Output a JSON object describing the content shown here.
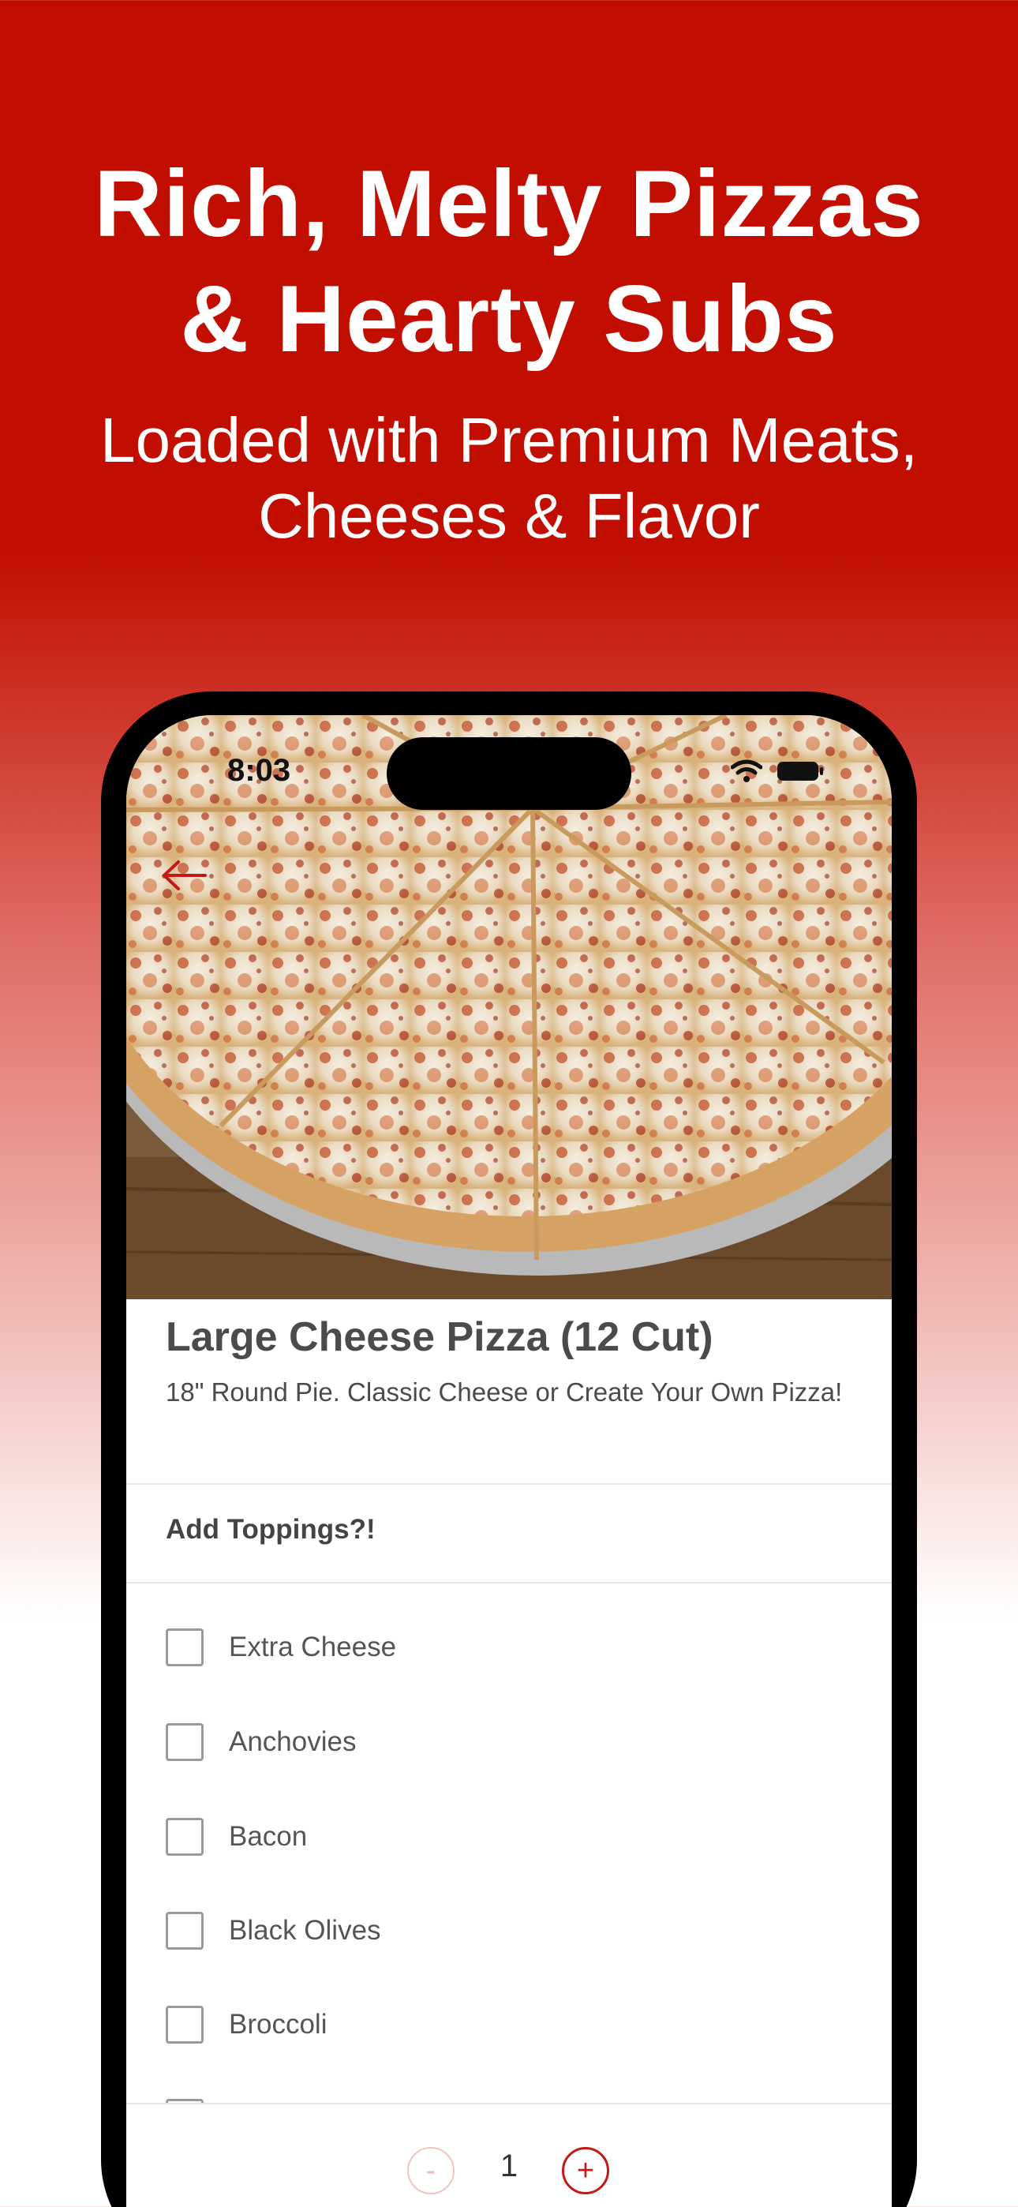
{
  "promo": {
    "headline_line1": "Rich, Melty Pizzas",
    "headline_line2": "& Hearty Subs",
    "subline_line1": "Loaded with Premium Meats,",
    "subline_line2": "Cheeses & Flavor"
  },
  "status_bar": {
    "time": "8:03",
    "icons": [
      "wifi-icon",
      "battery-icon"
    ]
  },
  "item": {
    "title": "Large Cheese Pizza (12 Cut)",
    "description": "18\" Round Pie. Classic Cheese or Create Your Own Pizza!"
  },
  "toppings": {
    "section_label": "Add Toppings?!",
    "options": [
      {
        "label": "Extra Cheese",
        "checked": false
      },
      {
        "label": "Anchovies",
        "checked": false
      },
      {
        "label": "Bacon",
        "checked": false
      },
      {
        "label": "Black Olives",
        "checked": false
      },
      {
        "label": "Broccoli",
        "checked": false
      }
    ]
  },
  "quantity": {
    "minus": "-",
    "value": "1",
    "plus": "+"
  },
  "colors": {
    "brand_red": "#c20e00",
    "accent_red": "#c21a14"
  }
}
